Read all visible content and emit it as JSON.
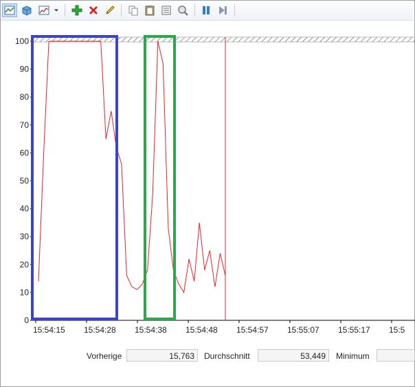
{
  "toolbar": {
    "icons": [
      "chart-view-icon",
      "3d-box-icon",
      "graph-type-icon",
      "dropdown-arrow-icon",
      "add-counter-icon",
      "delete-counter-icon",
      "highlight-pencil-icon",
      "copy-properties-icon",
      "paste-list-icon",
      "properties-icon",
      "zoom-icon",
      "pause-icon",
      "next-frame-icon"
    ]
  },
  "colors": {
    "series": "#e8202a",
    "blue_box": "#3a44c8",
    "green_box": "#2aa84a",
    "axis": "#000000",
    "grid": "#c8c8c8"
  },
  "chart_data": {
    "type": "line",
    "ylim": [
      0,
      100
    ],
    "yticks": [
      "0",
      "10",
      "20",
      "30",
      "40",
      "50",
      "60",
      "70",
      "80",
      "90",
      "100"
    ],
    "xticks": [
      "15:54:15",
      "15:54:28",
      "15:54:38",
      "15:54:48",
      "15:54:57",
      "15:55:07",
      "15:55:17",
      "15:5"
    ],
    "series": [
      {
        "values": [
          14,
          60,
          100,
          100,
          100,
          100,
          100,
          100,
          100,
          100,
          100,
          100,
          100,
          65,
          75,
          62,
          56,
          16,
          12,
          11,
          13,
          18,
          45,
          100,
          92,
          33,
          18,
          13,
          10,
          22,
          14,
          35,
          18,
          25,
          12,
          24,
          16
        ]
      }
    ]
  },
  "status": {
    "previous_label": "Vorherige",
    "previous_value": "15,763",
    "average_label": "Durchschnitt",
    "average_value": "53,449",
    "minimum_label": "Minimum",
    "minimum_value": ""
  }
}
